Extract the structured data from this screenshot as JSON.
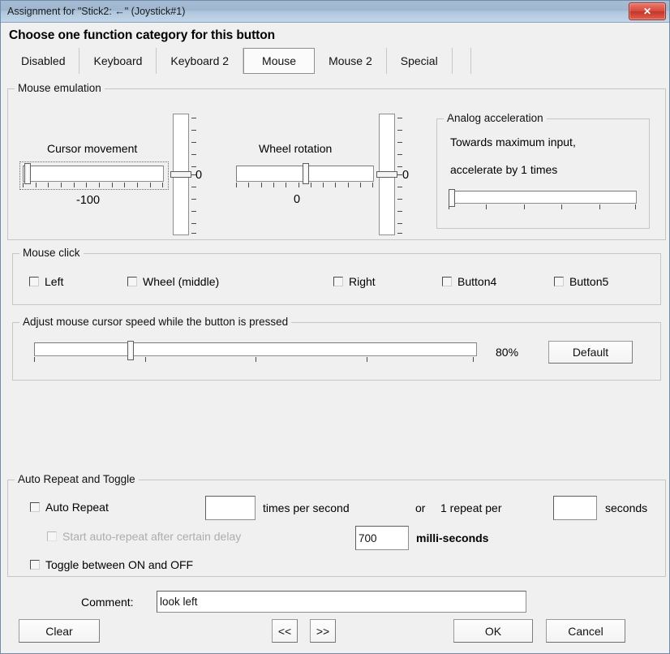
{
  "window": {
    "title": "Assignment for \"Stick2: ←\" (Joystick#1)",
    "close_label": "✕"
  },
  "header": {
    "heading": "Choose one function category for this button"
  },
  "tabs": [
    {
      "label": "Disabled",
      "selected": false
    },
    {
      "label": "Keyboard",
      "selected": false
    },
    {
      "label": "Keyboard 2",
      "selected": false
    },
    {
      "label": "Mouse",
      "selected": true
    },
    {
      "label": "Mouse 2",
      "selected": false
    },
    {
      "label": "Special",
      "selected": false
    }
  ],
  "mouse_emulation": {
    "legend": "Mouse emulation",
    "cursor_movement": {
      "label": "Cursor movement",
      "value": "-100",
      "thumb_percent": 2
    },
    "cursor_vertical": {
      "value": "0",
      "thumb_percent": 50
    },
    "wheel_rotation": {
      "label": "Wheel rotation",
      "value": "0",
      "thumb_percent": 50
    },
    "wheel_vertical": {
      "value": "0",
      "thumb_percent": 50
    },
    "analog_acceleration": {
      "legend": "Analog acceleration",
      "line1": "Towards maximum input,",
      "line2": "accelerate by 1 times",
      "thumb_percent": 0
    }
  },
  "mouse_click": {
    "legend": "Mouse click",
    "items": [
      {
        "label": "Left",
        "checked": false
      },
      {
        "label": "Wheel (middle)",
        "checked": false
      },
      {
        "label": "Right",
        "checked": false
      },
      {
        "label": "Button4",
        "checked": false
      },
      {
        "label": "Button5",
        "checked": false
      }
    ]
  },
  "cursor_speed": {
    "legend": "Adjust mouse cursor speed while the button is pressed",
    "value_text": "80%",
    "thumb_percent": 21,
    "default_button": "Default"
  },
  "auto_repeat": {
    "legend": "Auto Repeat and Toggle",
    "auto_repeat_label": "Auto Repeat",
    "auto_repeat_checked": false,
    "times_value": "",
    "times_label": "times per second",
    "or_label": "or",
    "repeat_per_label": "1 repeat per",
    "seconds_value": "",
    "seconds_label": "seconds",
    "delay_label": "Start auto-repeat after certain delay",
    "delay_checked": false,
    "delay_value": "700",
    "milliseconds_label": "milli-seconds",
    "toggle_label": "Toggle between ON and OFF",
    "toggle_checked": false
  },
  "footer": {
    "comment_label": "Comment:",
    "comment_value": "look left",
    "clear_button": "Clear",
    "prev_button": "<<",
    "next_button": ">>",
    "ok_button": "OK",
    "cancel_button": "Cancel"
  }
}
